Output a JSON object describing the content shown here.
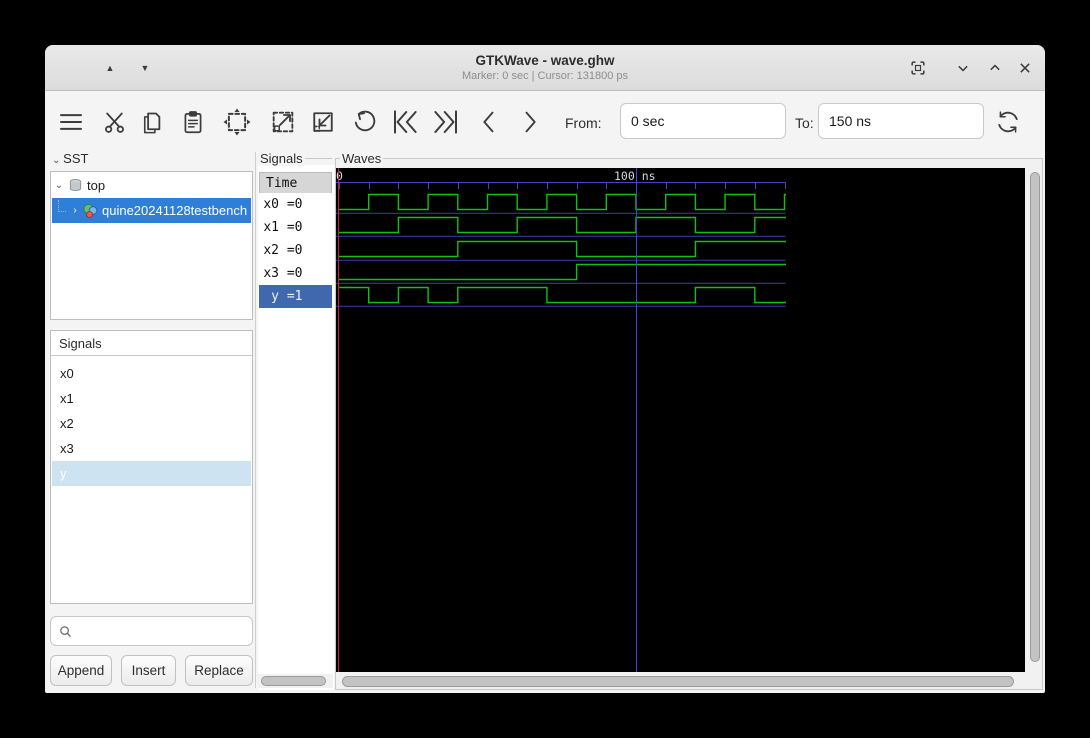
{
  "window": {
    "title": "GTKWave - wave.ghw",
    "subtitle": "Marker: 0 sec  |  Cursor: 131800 ps"
  },
  "toolbar": {
    "icons": [
      "menu",
      "cut",
      "copy",
      "paste",
      "zoom-fit",
      "zoom-in",
      "zoom-out",
      "undo",
      "to-start",
      "to-end",
      "step-left",
      "step-right",
      "reload"
    ],
    "from_label": "From:",
    "from_value": "0 sec",
    "to_label": "To:",
    "to_value": "150 ns"
  },
  "sst": {
    "label": "SST",
    "tree": [
      {
        "label": "top",
        "selected": false
      },
      {
        "label": "quine20241128testbench",
        "selected": true
      }
    ]
  },
  "signal_search": {
    "frame_label": "Signals",
    "items": [
      "x0",
      "x1",
      "x2",
      "x3",
      "y"
    ],
    "selected": "y",
    "search_placeholder": "",
    "buttons": {
      "append": "Append",
      "insert": "Insert",
      "replace": "Replace"
    }
  },
  "signals_panel": {
    "frame_label": "Signals",
    "header": "Time",
    "rows": [
      {
        "name": "x0",
        "value": "0",
        "selected": false
      },
      {
        "name": "x1",
        "value": "0",
        "selected": false
      },
      {
        "name": "x2",
        "value": "0",
        "selected": false
      },
      {
        "name": "x3",
        "value": "0",
        "selected": false
      },
      {
        "name": "y",
        "value": "1",
        "selected": true
      }
    ]
  },
  "waves": {
    "frame_label": "Waves"
  },
  "chart_data": {
    "type": "digital-timing",
    "time_unit": "ns",
    "t_start": 0,
    "t_end": 150,
    "tick_interval_ns": 10,
    "timeline_labels": [
      {
        "t": 0,
        "label": "0"
      },
      {
        "t": 100,
        "label": "100 ns"
      }
    ],
    "marker_line_ns": 0,
    "cursor_line_ns": 100,
    "signals": [
      {
        "name": "x0",
        "transitions": [
          [
            0,
            0
          ],
          [
            10,
            1
          ],
          [
            20,
            0
          ],
          [
            30,
            1
          ],
          [
            40,
            0
          ],
          [
            50,
            1
          ],
          [
            60,
            0
          ],
          [
            70,
            1
          ],
          [
            80,
            0
          ],
          [
            90,
            1
          ],
          [
            100,
            0
          ],
          [
            110,
            1
          ],
          [
            120,
            0
          ],
          [
            130,
            1
          ],
          [
            140,
            0
          ],
          [
            150,
            1
          ]
        ]
      },
      {
        "name": "x1",
        "transitions": [
          [
            0,
            0
          ],
          [
            20,
            1
          ],
          [
            40,
            0
          ],
          [
            60,
            1
          ],
          [
            80,
            0
          ],
          [
            100,
            1
          ],
          [
            120,
            0
          ],
          [
            140,
            1
          ]
        ]
      },
      {
        "name": "x2",
        "transitions": [
          [
            0,
            0
          ],
          [
            40,
            1
          ],
          [
            80,
            0
          ],
          [
            120,
            1
          ]
        ]
      },
      {
        "name": "x3",
        "transitions": [
          [
            0,
            0
          ],
          [
            80,
            1
          ]
        ]
      },
      {
        "name": "y",
        "transitions": [
          [
            0,
            1
          ],
          [
            10,
            0
          ],
          [
            20,
            1
          ],
          [
            30,
            0
          ],
          [
            40,
            1
          ],
          [
            70,
            0
          ],
          [
            120,
            1
          ],
          [
            140,
            0
          ]
        ]
      }
    ]
  },
  "colors": {
    "wave_green": "#12c012",
    "grid_blue": "#4444bb",
    "divider_blue": "#3d3dae",
    "cursor_blue": "#4646d0",
    "marker_red": "#bb2a20",
    "tree_selection": "#2f7fd8",
    "trace_selection": "#4068ae",
    "list_selection": "#cde3f2"
  }
}
